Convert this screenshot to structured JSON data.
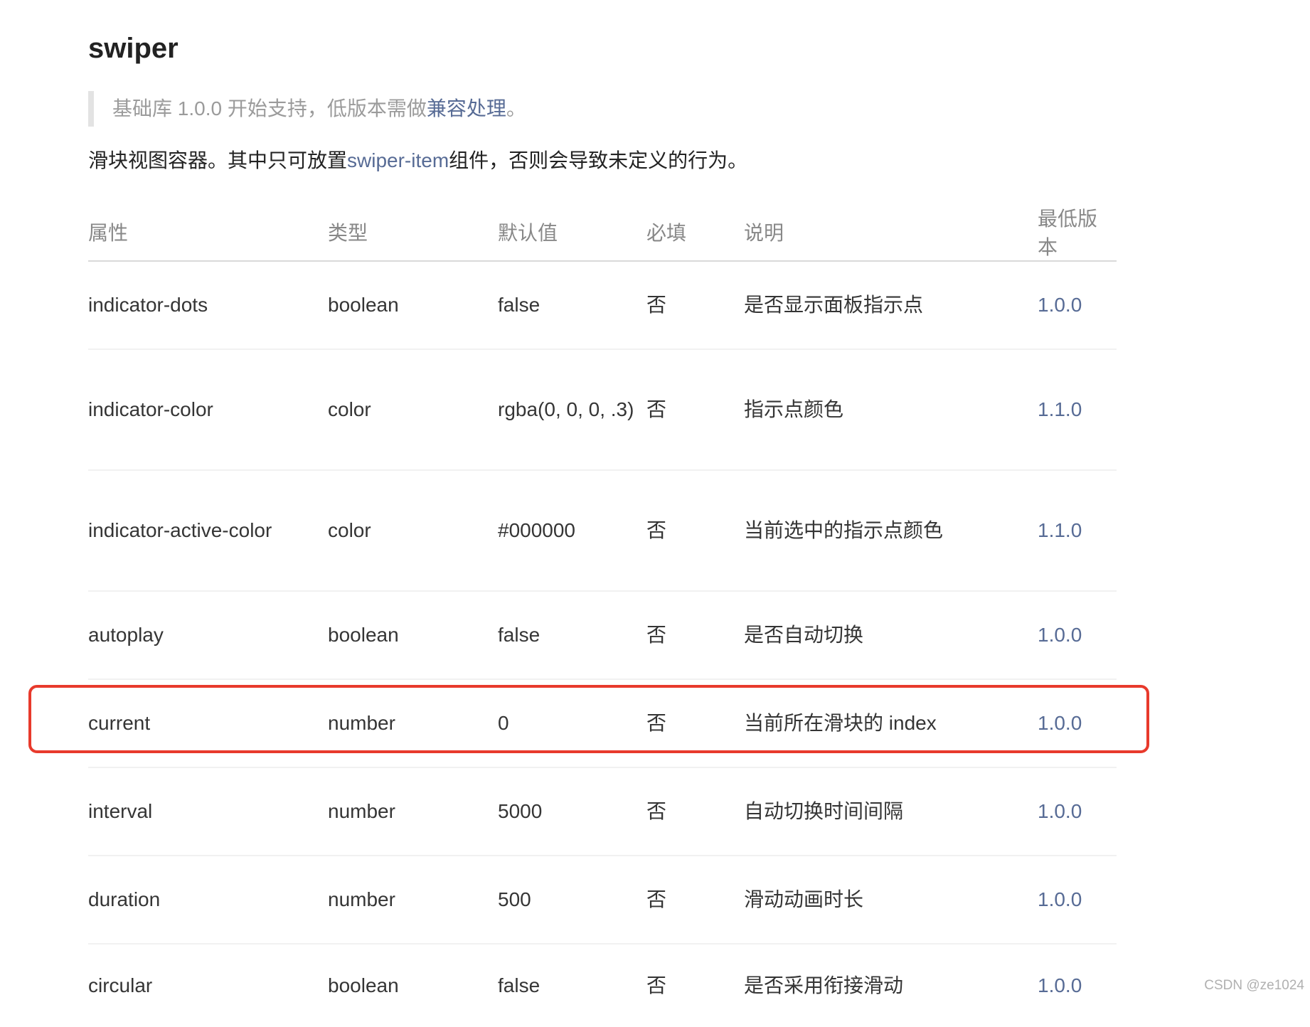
{
  "title": "swiper",
  "note": {
    "prefix": "基础库 1.0.0 开始支持，低版本需做",
    "link": "兼容处理",
    "suffix": "。"
  },
  "desc": {
    "prefix": "滑块视图容器。其中只可放置",
    "link": "swiper-item",
    "suffix": "组件，否则会导致未定义的行为。"
  },
  "table": {
    "headers": [
      "属性",
      "类型",
      "默认值",
      "必填",
      "说明",
      "最低版本"
    ],
    "rows": [
      {
        "prop": "indicator-dots",
        "type": "boolean",
        "default": "false",
        "required": "否",
        "desc": "是否显示面板指示点",
        "version": "1.0.0"
      },
      {
        "prop": "indicator-color",
        "type": "color",
        "default": "rgba(0, 0, 0, .3)",
        "required": "否",
        "desc": "指示点颜色",
        "version": "1.1.0"
      },
      {
        "prop": "indicator-active-color",
        "type": "color",
        "default": "#000000",
        "required": "否",
        "desc": "当前选中的指示点颜色",
        "version": "1.1.0"
      },
      {
        "prop": "autoplay",
        "type": "boolean",
        "default": "false",
        "required": "否",
        "desc": "是否自动切换",
        "version": "1.0.0"
      },
      {
        "prop": "current",
        "type": "number",
        "default": "0",
        "required": "否",
        "desc": "当前所在滑块的 index",
        "version": "1.0.0"
      },
      {
        "prop": "interval",
        "type": "number",
        "default": "5000",
        "required": "否",
        "desc": "自动切换时间间隔",
        "version": "1.0.0"
      },
      {
        "prop": "duration",
        "type": "number",
        "default": "500",
        "required": "否",
        "desc": "滑动动画时长",
        "version": "1.0.0"
      },
      {
        "prop": "circular",
        "type": "boolean",
        "default": "false",
        "required": "否",
        "desc": "是否采用衔接滑动",
        "version": "1.0.0"
      }
    ]
  },
  "watermark": "CSDN @ze1024",
  "colors": {
    "link": "#576b95",
    "highlight": "#e83a2c"
  }
}
